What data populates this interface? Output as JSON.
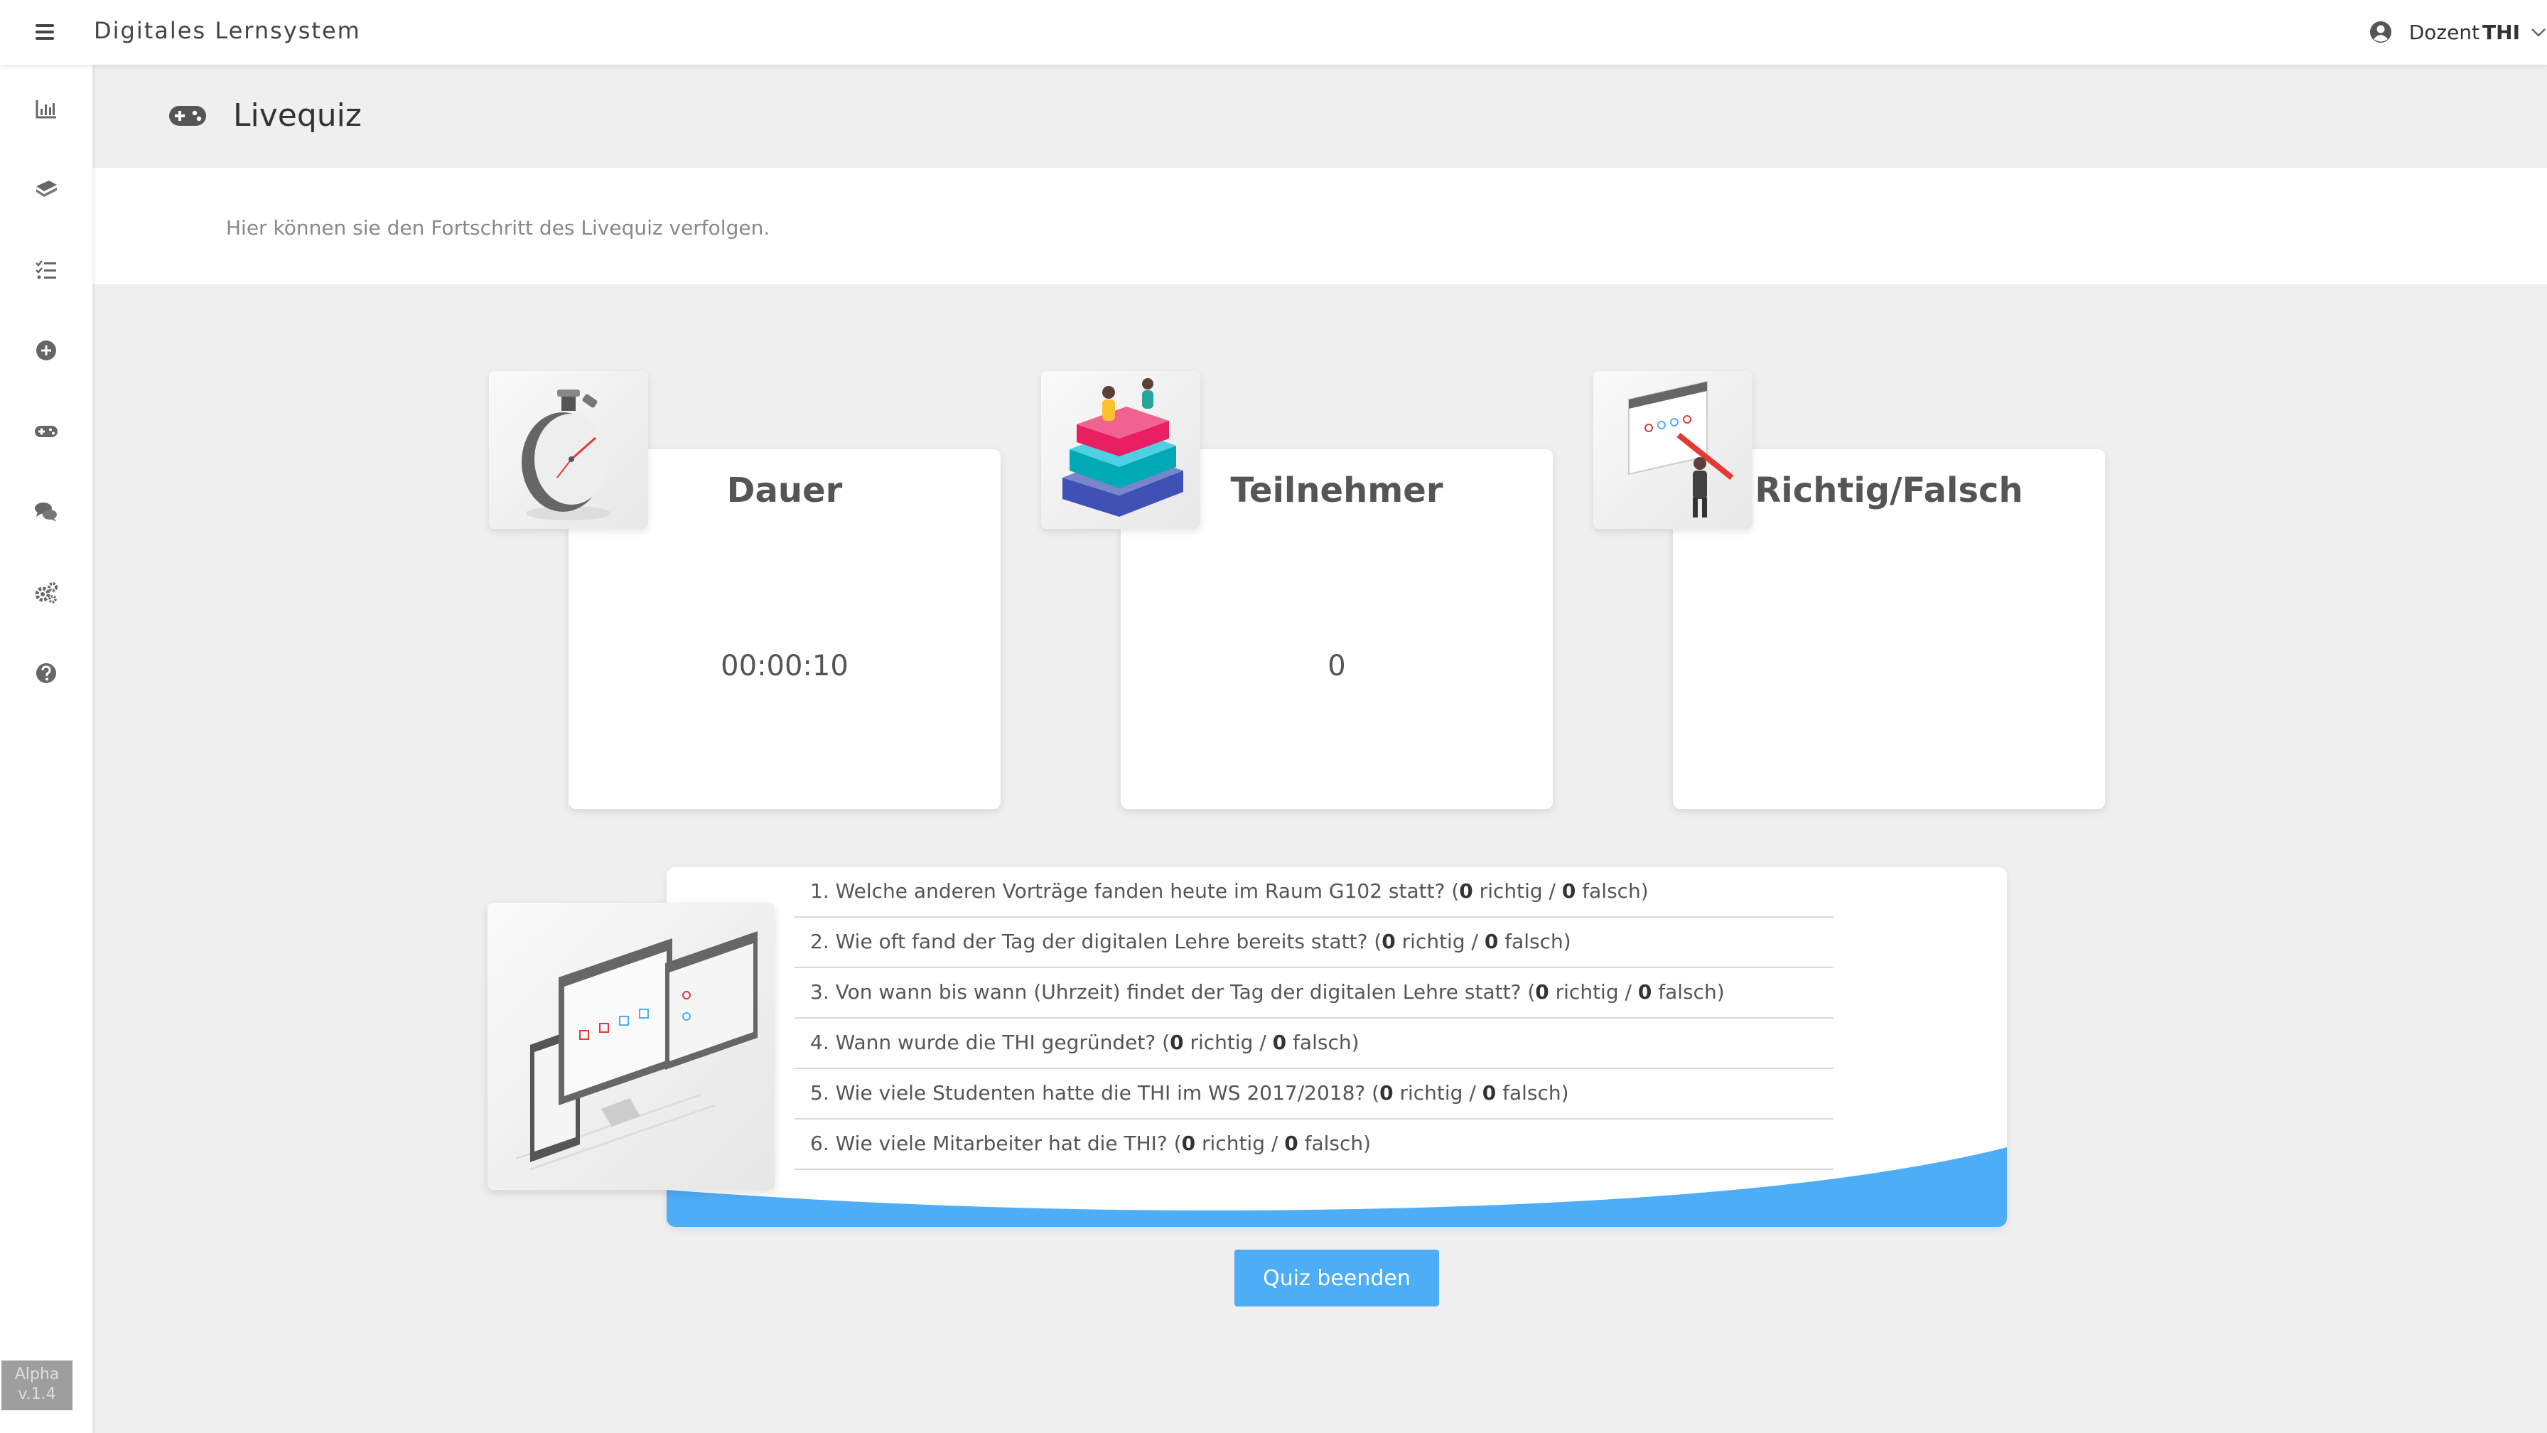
{
  "app": {
    "title": "Digitales Lernsystem"
  },
  "user": {
    "label": "Dozent",
    "name": "THI"
  },
  "sidebar": {
    "items": [
      {
        "name": "statistics",
        "icon": "bar-chart-icon"
      },
      {
        "name": "modules",
        "icon": "layers-icon"
      },
      {
        "name": "tasks",
        "icon": "checklist-icon"
      },
      {
        "name": "add",
        "icon": "plus-circle-icon"
      },
      {
        "name": "livequiz",
        "icon": "gamepad-icon"
      },
      {
        "name": "chat",
        "icon": "chat-icon"
      },
      {
        "name": "settings",
        "icon": "gears-icon"
      },
      {
        "name": "help",
        "icon": "help-icon"
      }
    ],
    "version_line1": "Alpha",
    "version_line2": "v.1.4"
  },
  "page": {
    "title": "Livequiz",
    "icon": "gamepad-icon",
    "intro": "Hier können sie den Fortschritt des Livequiz verfolgen."
  },
  "cards": [
    {
      "title": "Dauer",
      "value": "00:00:10",
      "icon": "stopwatch-illustration"
    },
    {
      "title": "Teilnehmer",
      "value": "0",
      "icon": "books-illustration"
    },
    {
      "title": "Richtig/Falsch",
      "value": "",
      "icon": "quiz-board-illustration"
    }
  ],
  "questions": [
    {
      "text": "1. Welche anderen Vorträge fanden heute im Raum G102 statt? (",
      "correct": "0",
      "mid": " richtig / ",
      "wrong": "0",
      "end": " falsch)"
    },
    {
      "text": "2. Wie oft fand der Tag der digitalen Lehre bereits statt? (",
      "correct": "0",
      "mid": " richtig / ",
      "wrong": "0",
      "end": " falsch)"
    },
    {
      "text": "3. Von wann bis wann (Uhrzeit) findet der Tag der digitalen Lehre statt? (",
      "correct": "0",
      "mid": " richtig / ",
      "wrong": "0",
      "end": " falsch)"
    },
    {
      "text": "4. Wann wurde die THI gegründet? (",
      "correct": "0",
      "mid": " richtig / ",
      "wrong": "0",
      "end": " falsch)"
    },
    {
      "text": "5. Wie viele Studenten hatte die THI im WS 2017/2018? (",
      "correct": "0",
      "mid": " richtig / ",
      "wrong": "0",
      "end": " falsch)"
    },
    {
      "text": "6. Wie viele Mitarbeiter hat die THI? (",
      "correct": "0",
      "mid": " richtig / ",
      "wrong": "0",
      "end": " falsch)"
    }
  ],
  "actions": {
    "end_quiz": "Quiz beenden"
  },
  "colors": {
    "accent": "#4dadf7",
    "wave": "#4dadf7"
  }
}
